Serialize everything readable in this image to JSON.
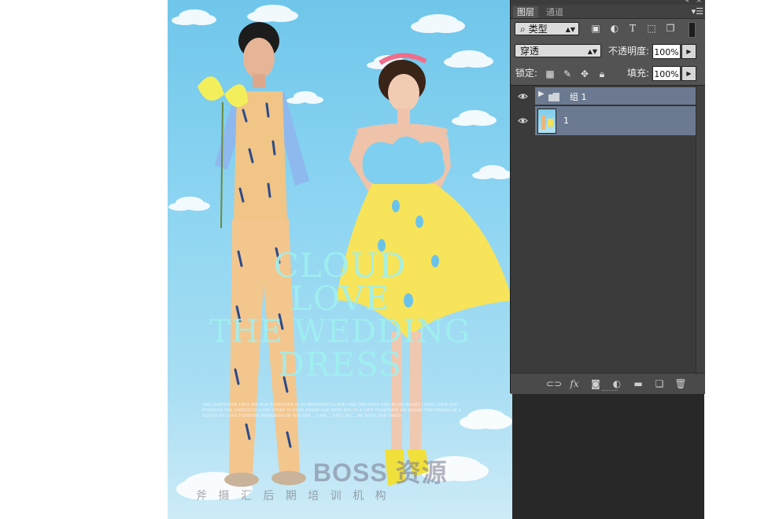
{
  "poster": {
    "title_lines": [
      "CLOUD",
      "LOVE",
      "THE WEDDING",
      "DRESS"
    ],
    "small_text": "THE HAPPINESS THAT WE HAD TOGETHER IS SO WONDERFUL YOU ARE THE ONLY ONE IN MY HEART I WILL LOVE YOU FOREVER THE SWEETEST LOVE STORY IS OURS EVERY DAY WITH YOU IS A GIFT TOGETHER WE SHARE THE DREAM OF A CLOUD OF LOVE FOREVER MEMORIES IN THE SKY ... I AM ... YES I DO ... BE WITH THE TIMES"
  },
  "watermark": {
    "brand": "BOSS 资源",
    "line": "斧 摄 汇 后 期 培 训 机 构"
  },
  "panel": {
    "tabs": [
      {
        "label": "图层",
        "active": true
      },
      {
        "label": "通道",
        "active": false
      }
    ],
    "filter": {
      "label": "类型",
      "icons": [
        "image-filter-icon",
        "adjustment-filter-icon",
        "type-filter-icon",
        "shape-filter-icon",
        "smart-object-filter-icon"
      ]
    },
    "blend_mode": "穿透",
    "opacity_label": "不透明度:",
    "opacity_value": "100%",
    "lock_label": "锁定:",
    "fill_label": "填充:",
    "fill_value": "100%",
    "layers": [
      {
        "name": "组 1",
        "type": "group",
        "visible": true
      },
      {
        "name": "1",
        "type": "image",
        "visible": true
      }
    ],
    "bottom_icons": [
      "link-layers-icon",
      "fx-icon",
      "add-mask-icon",
      "new-adjustment-icon",
      "new-group-icon",
      "new-layer-icon",
      "delete-layer-icon"
    ]
  },
  "colors": {
    "panel_bg": "#535353",
    "layer_selected": "#6b7a90",
    "workspace": "#282828"
  }
}
